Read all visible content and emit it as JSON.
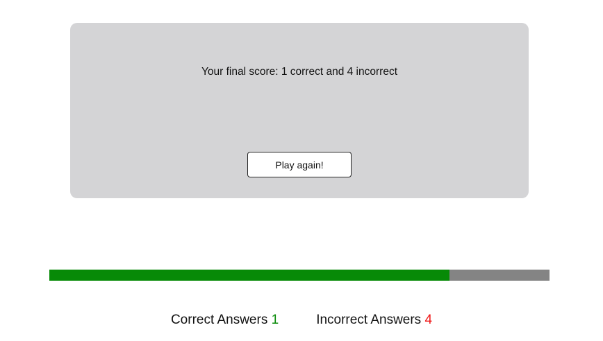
{
  "result": {
    "final_score_text": "Your final score: 1 correct and 4 incorrect",
    "play_again_label": "Play again!"
  },
  "progress": {
    "fraction_filled": 0.8,
    "fill_color": "#078a07",
    "track_color": "#848484"
  },
  "tally": {
    "correct_label": "Correct Answers",
    "correct_count": "1",
    "correct_color": "#078a07",
    "incorrect_label": "Incorrect Answers",
    "incorrect_count": "4",
    "incorrect_color": "#f01818"
  }
}
